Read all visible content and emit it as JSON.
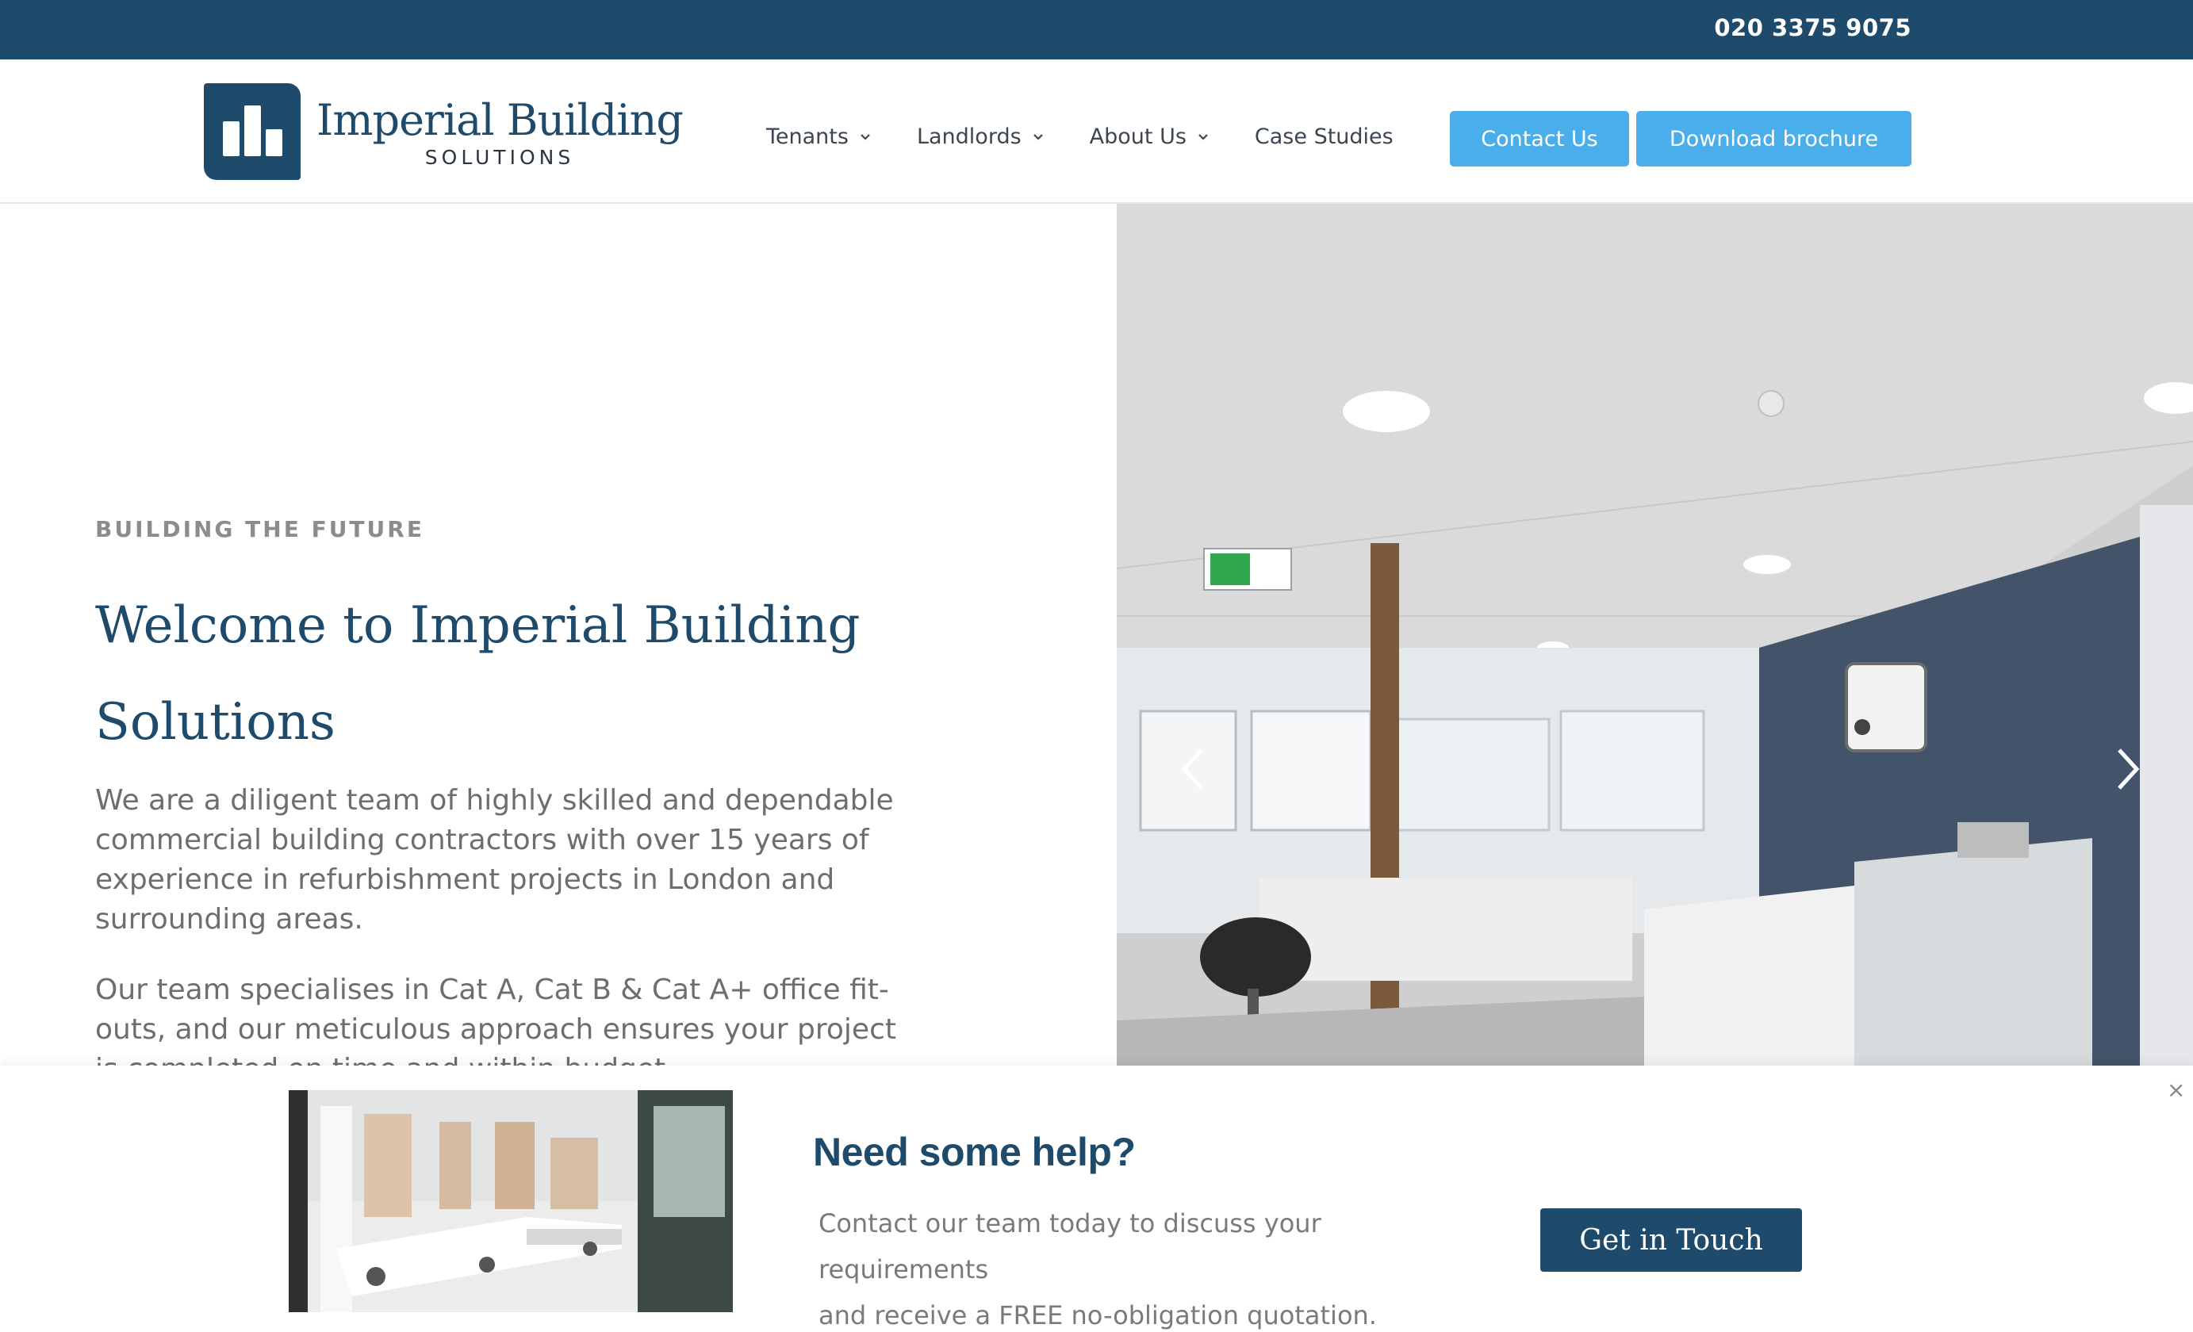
{
  "topbar": {
    "phone": "020 3375 9075"
  },
  "logo": {
    "title": "Imperial Building",
    "subtitle": "SOLUTIONS"
  },
  "nav": {
    "items": [
      {
        "label": "Tenants",
        "has_dropdown": true
      },
      {
        "label": "Landlords",
        "has_dropdown": true
      },
      {
        "label": "About Us",
        "has_dropdown": true
      },
      {
        "label": "Case Studies",
        "has_dropdown": false
      }
    ],
    "contact_label": "Contact Us",
    "brochure_label": "Download brochure"
  },
  "hero": {
    "eyebrow": "BUILDING THE FUTURE",
    "title_line1": "Welcome to Imperial Building",
    "title_line2": "Solutions",
    "paragraph1": "We are a diligent team of highly skilled and dependable commercial building contractors with over 15 years of experience in refurbishment projects in London and surrounding areas.",
    "paragraph2": "Our team specialises in Cat A, Cat B & Cat A+ office fit-outs, and our meticulous approach ensures your project is completed on time and within budget."
  },
  "slider": {
    "prev_icon": "chevron-left-icon",
    "next_icon": "chevron-right-icon"
  },
  "popup": {
    "title": "Need some help?",
    "text_line1": "Contact our team today to discuss your requirements",
    "text_line2": "and receive a FREE no-obligation quotation.",
    "button_label": "Get in Touch",
    "close_glyph": "×"
  },
  "colors": {
    "brand_navy": "#1e4a6b",
    "accent_blue": "#4aaeea",
    "text_grey": "#6e6e6e"
  }
}
